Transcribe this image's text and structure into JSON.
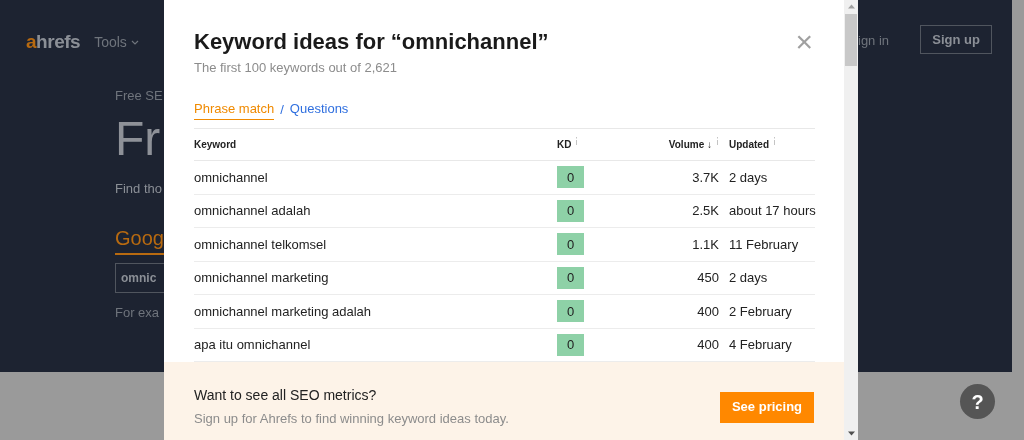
{
  "background": {
    "logo": {
      "accent": "a",
      "rest": "hrefs"
    },
    "nav": [
      "Tools"
    ],
    "eyebrow": "Free SE",
    "hero_title": "Fr",
    "hero_text": "Find tho",
    "tool_link": "Goog",
    "search_value": "omnic",
    "example_text": "For exa",
    "sign_in": "ign in",
    "sign_up": "Sign up",
    "help": "?"
  },
  "modal": {
    "title": "Keyword ideas for “omnichannel”",
    "subtitle": "The first 100 keywords out of 2,621",
    "close": "×",
    "tabs": [
      {
        "label": "Phrase match",
        "selected": true
      },
      {
        "label": "Questions",
        "selected": false
      }
    ],
    "tab_separator": "/",
    "columns": [
      {
        "label": "Keyword",
        "info": false
      },
      {
        "label": "KD",
        "info": true
      },
      {
        "label": "Volume",
        "info": true,
        "sort": "↓"
      },
      {
        "label": "Updated",
        "info": true
      }
    ],
    "rows": [
      {
        "keyword": "omnichannel",
        "kd": "0",
        "volume": "3.7K",
        "updated": "2 days"
      },
      {
        "keyword": "omnichannel adalah",
        "kd": "0",
        "volume": "2.5K",
        "updated": "about 17 hours"
      },
      {
        "keyword": "omnichannel telkomsel",
        "kd": "0",
        "volume": "1.1K",
        "updated": "11 February"
      },
      {
        "keyword": "omnichannel marketing",
        "kd": "0",
        "volume": "450",
        "updated": "2 days"
      },
      {
        "keyword": "omnichannel marketing adalah",
        "kd": "0",
        "volume": "400",
        "updated": "2 February"
      },
      {
        "keyword": "apa itu omnichannel",
        "kd": "0",
        "volume": "400",
        "updated": "4 February"
      }
    ],
    "footer": {
      "heading": "Want to see all SEO metrics?",
      "text": "Sign up for Ahrefs to find winning keyword ideas today.",
      "button": "See pricing"
    }
  }
}
